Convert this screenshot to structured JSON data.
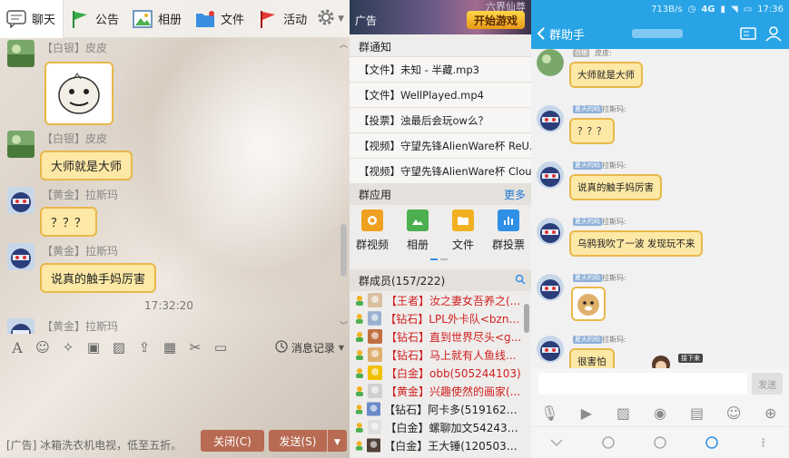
{
  "left": {
    "tabs": [
      {
        "label": "聊天",
        "icon": "chat-icon"
      },
      {
        "label": "公告",
        "icon": "flag-icon"
      },
      {
        "label": "相册",
        "icon": "photo-icon"
      },
      {
        "label": "文件",
        "icon": "folder-icon"
      },
      {
        "label": "活动",
        "icon": "activity-flag-icon"
      }
    ],
    "messages": [
      {
        "name": "【白银】皮皮",
        "type": "emoticon"
      },
      {
        "name": "【白银】皮皮",
        "text": "大师就是大师"
      },
      {
        "name": "【黄金】拉斯玛",
        "text": "？？？"
      },
      {
        "name": "【黄金】拉斯玛",
        "text": "说真的触手妈厉害"
      },
      {
        "name": "【黄金】拉斯玛",
        "text": ""
      }
    ],
    "timestamp": "17:32:20",
    "history_label": "消息记录",
    "footer_ad": "[广告] 冰箱洗衣机电视，低至五折。",
    "close_label": "关闭(C)",
    "send_label": "发送(S)"
  },
  "middle": {
    "ad": {
      "label": "广告",
      "title": "六界仙尊",
      "button": "开始游戏"
    },
    "notice_title": "群通知",
    "notices": [
      "【文件】未知 - 半藏.mp3",
      "【文件】WellPlayed.mp4",
      "【投票】浊最后会玩ow么？",
      "【视频】守望先锋AlienWare杯 ReU...",
      "【视频】守望先锋AlienWare杯 Clou..."
    ],
    "apps_title": "群应用",
    "more_label": "更多",
    "apps": [
      {
        "label": "群视频",
        "icon": "video-app-icon",
        "color": "#f0a020"
      },
      {
        "label": "相册",
        "icon": "album-app-icon",
        "color": "#4caf50"
      },
      {
        "label": "文件",
        "icon": "file-app-icon",
        "color": "#f0b020"
      },
      {
        "label": "群投票",
        "icon": "vote-app-icon",
        "color": "#2f8fe6"
      }
    ],
    "members_title": "群成员(157/222)",
    "members": [
      {
        "text": "【王者】汝之妻女吾养之(...",
        "color": "#d02020"
      },
      {
        "text": "【钻石】LPL外卡队<bznk...",
        "color": "#d02020"
      },
      {
        "text": "【钻石】直到世界尽头<g...",
        "color": "#d02020"
      },
      {
        "text": "【钻石】马上就有人鱼线...",
        "color": "#d02020"
      },
      {
        "text": "【白金】obb(505244103)",
        "color": "#d02020"
      },
      {
        "text": "【黄金】兴趣使然的画家(...",
        "color": "#d02020"
      },
      {
        "text": "【钻石】阿卡多(519162324)",
        "color": "#222222"
      },
      {
        "text": "【白金】螺聊加文542430...",
        "color": "#222222"
      },
      {
        "text": "【白金】王大锤(12050391...",
        "color": "#222222"
      }
    ]
  },
  "right": {
    "status": {
      "speed": "713B/s",
      "network": "4G",
      "time": "17:36"
    },
    "title": "群助手",
    "messages": [
      {
        "badge": "白银",
        "name": "皮皮:",
        "text": "大师就是大师"
      },
      {
        "badge": "夏天的码",
        "name": "拉斯玛:",
        "text": "？？？"
      },
      {
        "badge": "夏天的码",
        "name": "拉斯玛:",
        "text": "说真的触手妈厉害"
      },
      {
        "badge": "夏天的码",
        "name": "拉斯玛:",
        "text": "乌鸦我吹了一波 发现玩不来"
      },
      {
        "badge": "夏天的码",
        "name": "拉斯玛:",
        "type": "sticker"
      },
      {
        "badge": "夏天的码",
        "name": "拉斯玛:",
        "text": "很害怕"
      }
    ],
    "send_label": "发送",
    "float_badge": "接下来"
  },
  "colors": {
    "accent": "#28a4e6",
    "bubble": "#fde8a6",
    "bubble_border": "#e8b84a",
    "button": "#b86a52"
  }
}
